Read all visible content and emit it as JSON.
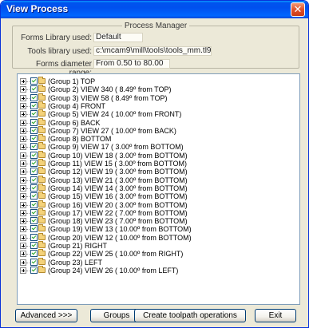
{
  "window": {
    "title": "View Process",
    "close_glyph": "✕"
  },
  "process_manager": {
    "legend": "Process Manager",
    "forms_library_label": "Forms Library used:",
    "forms_library_value": "Default",
    "tools_library_label": "Tools library used:",
    "tools_library_value": "c:\\mcam9\\mill\\tools\\tools_mm.tl9",
    "forms_diameter_label": "Forms diameter range:",
    "forms_diameter_value": "From 0.50 to 80.00"
  },
  "tree": {
    "items": [
      "(Group 1)  TOP",
      "(Group 2)  VIEW 340  ( 8.49º from TOP)",
      "(Group 3)  VIEW 58  ( 8.49º from TOP)",
      "(Group 4)  FRONT",
      "(Group 5)  VIEW 24  ( 10.00º from FRONT)",
      "(Group 6)  BACK",
      "(Group 7)  VIEW 27  ( 10.00º from BACK)",
      "(Group 8)  BOTTOM",
      "(Group 9)  VIEW 17  ( 3.00º from BOTTOM)",
      "(Group 10)  VIEW 18  ( 3.00º from BOTTOM)",
      "(Group 11)  VIEW 15  ( 3.00º from BOTTOM)",
      "(Group 12)  VIEW 19  ( 3.00º from BOTTOM)",
      "(Group 13)  VIEW 21  ( 3.00º from BOTTOM)",
      "(Group 14)  VIEW 14  ( 3.00º from BOTTOM)",
      "(Group 15)  VIEW 16  ( 3.00º from BOTTOM)",
      "(Group 16)  VIEW 20  ( 3.00º from BOTTOM)",
      "(Group 17)  VIEW 22  ( 7.00º from BOTTOM)",
      "(Group 18)  VIEW 23  ( 7.00º from BOTTOM)",
      "(Group 19)  VIEW 13  ( 10.00º from BOTTOM)",
      "(Group 20)  VIEW 12  ( 10.00º from BOTTOM)",
      "(Group 21)  RIGHT",
      "(Group 22)  VIEW 25  ( 10.00º from RIGHT)",
      "(Group 23)  LEFT",
      "(Group 24)  VIEW 26  ( 10.00º from LEFT)"
    ]
  },
  "buttons": {
    "advanced": "Advanced >>>",
    "groups": "Groups",
    "create_toolpath": "Create toolpath operations",
    "exit": "Exit"
  }
}
